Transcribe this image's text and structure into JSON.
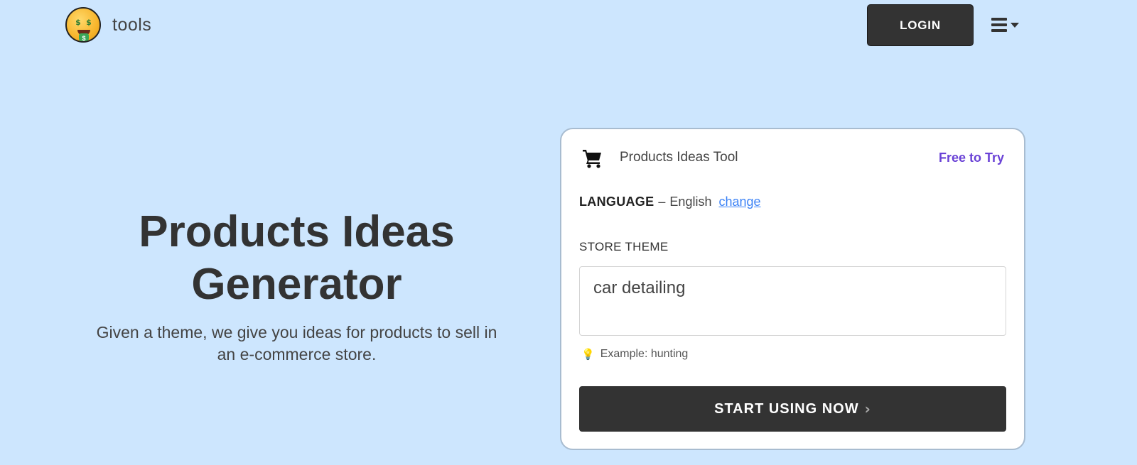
{
  "header": {
    "logo_text": "tools",
    "logo_icon": "money-mouth-face-icon",
    "login_label": "LOGIN",
    "menu_icon": "hamburger-icon"
  },
  "hero": {
    "title_line1": "Products Ideas",
    "title_line2": "Generator",
    "subtitle_line1": "Given a theme, we give you ideas for products to sell in",
    "subtitle_line2": "an e-commerce store."
  },
  "tool": {
    "icon": "shopping-cart-icon",
    "title": "Products Ideas Tool",
    "free_label": "Free to Try",
    "language_label": "LANGUAGE",
    "language_separator": "–",
    "language_value": "English",
    "change_label": "change",
    "store_theme_label": "STORE THEME",
    "store_theme_value": "car detailing",
    "hint_icon": "lightbulb-icon",
    "hint_text": "Example: hunting",
    "start_label": "START USING NOW",
    "start_icon": "chevron-right-icon"
  },
  "colors": {
    "background": "#cde6fe",
    "button_dark": "#333333",
    "accent_purple": "#6a42d6",
    "link_blue": "#3b82f6"
  }
}
